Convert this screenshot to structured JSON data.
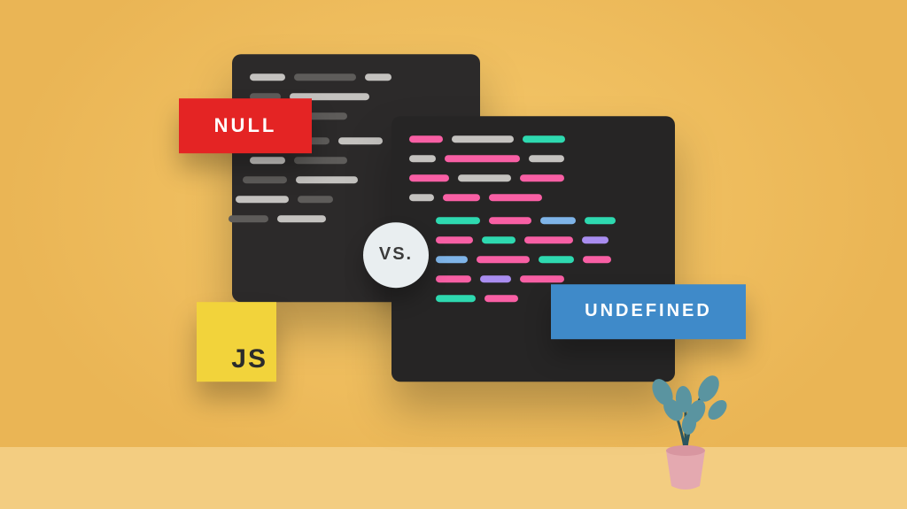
{
  "labels": {
    "null": "NULL",
    "undefined": "UNDEFINED",
    "vs": "VS.",
    "js": "JS"
  }
}
